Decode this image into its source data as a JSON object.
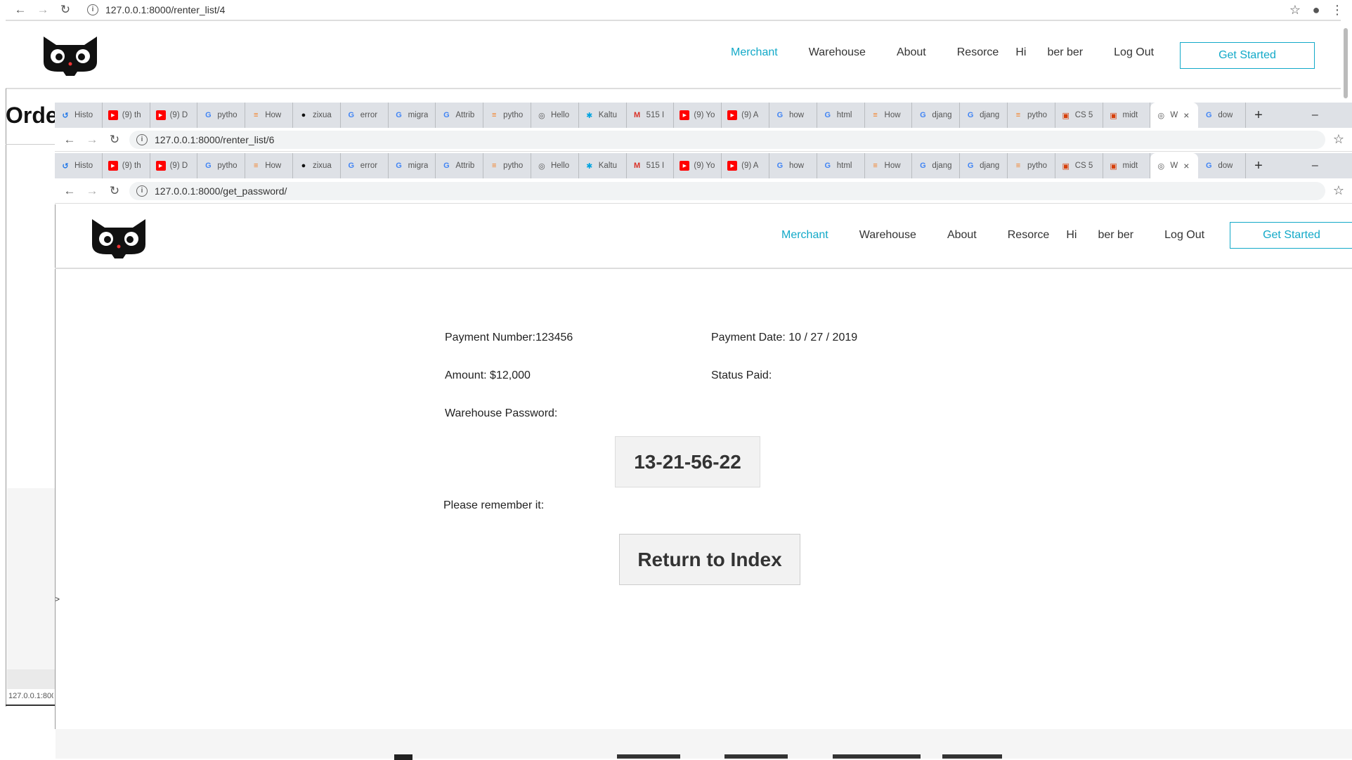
{
  "back_window": {
    "url": "127.0.0.1:8000/renter_list/4",
    "heading_fragment": "Orde",
    "status_url": "127.0.0.1:800",
    "caret": ">"
  },
  "middle_window": {
    "url": "127.0.0.1:8000/renter_list/6"
  },
  "front_window": {
    "url": "127.0.0.1:8000/get_password/"
  },
  "tabs": [
    {
      "label": "Histo",
      "icon": "history-icon",
      "color": "#1a73e8"
    },
    {
      "label": "(9) th",
      "icon": "youtube-icon",
      "color": "#ff0000"
    },
    {
      "label": "(9) D",
      "icon": "youtube-icon",
      "color": "#ff0000"
    },
    {
      "label": "pytho",
      "icon": "google-icon",
      "color": "#4285f4"
    },
    {
      "label": "How",
      "icon": "stackoverflow-icon",
      "color": "#f48024"
    },
    {
      "label": "zixua",
      "icon": "github-icon",
      "color": "#111111"
    },
    {
      "label": "error",
      "icon": "google-icon",
      "color": "#4285f4"
    },
    {
      "label": "migra",
      "icon": "google-icon",
      "color": "#4285f4"
    },
    {
      "label": "Attrib",
      "icon": "google-icon",
      "color": "#4285f4"
    },
    {
      "label": "pytho",
      "icon": "stackoverflow-icon",
      "color": "#f48024"
    },
    {
      "label": "Hello",
      "icon": "globe-icon",
      "color": "#555555"
    },
    {
      "label": "Kaltu",
      "icon": "kaltura-icon",
      "color": "#00a3e0"
    },
    {
      "label": "515 I",
      "icon": "gmail-icon",
      "color": "#d93025"
    },
    {
      "label": "(9) Yo",
      "icon": "youtube-icon",
      "color": "#ff0000"
    },
    {
      "label": "(9) A",
      "icon": "youtube-icon",
      "color": "#ff0000"
    },
    {
      "label": "how",
      "icon": "google-icon",
      "color": "#4285f4"
    },
    {
      "label": "html",
      "icon": "google-icon",
      "color": "#4285f4"
    },
    {
      "label": "How",
      "icon": "stackoverflow-icon",
      "color": "#f48024"
    },
    {
      "label": "djang",
      "icon": "google-icon",
      "color": "#4285f4"
    },
    {
      "label": "djang",
      "icon": "google-icon",
      "color": "#4285f4"
    },
    {
      "label": "pytho",
      "icon": "stackoverflow-icon",
      "color": "#f48024"
    },
    {
      "label": "CS 5",
      "icon": "osu-coe-icon",
      "color": "#d73f09"
    },
    {
      "label": "midt",
      "icon": "osu-coe-icon",
      "color": "#d73f09"
    },
    {
      "label": "W",
      "icon": "globe-icon",
      "color": "#555555",
      "active": true
    },
    {
      "label": "dow",
      "icon": "google-icon",
      "color": "#4285f4"
    }
  ],
  "site_nav": {
    "merchant": "Merchant",
    "warehouse": "Warehouse",
    "about": "About",
    "resource": "Resorce",
    "hi": "Hi",
    "username": "ber ber",
    "logout": "Log Out",
    "get_started": "Get Started"
  },
  "payment": {
    "number_label": "Payment Number:",
    "number_value": "123456",
    "date_label": "Payment Date:",
    "date_value": "10 / 27 / 2019",
    "amount_label": "Amount:",
    "amount_value": "$12,000",
    "status_label": "Status Paid:",
    "password_label": "Warehouse Password:",
    "password_value": "13-21-56-22",
    "reminder": "Please remember it:",
    "return_button": "Return to Index"
  },
  "colors": {
    "accent": "#12a9c8",
    "tabstrip": "#dee1e6"
  }
}
